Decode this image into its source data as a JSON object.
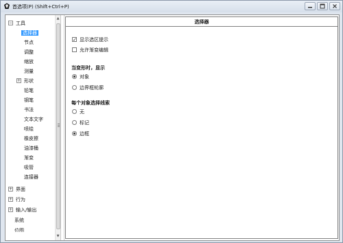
{
  "window": {
    "title": "首选项(P) (Shift+Ctrl+P)"
  },
  "tree": {
    "items": [
      {
        "label": "工具",
        "expander": "−",
        "level": 0
      },
      {
        "label": "选择器",
        "level": 1,
        "selected": true
      },
      {
        "label": "节点",
        "level": 1
      },
      {
        "label": "调整",
        "level": 1
      },
      {
        "label": "缩放",
        "level": 1
      },
      {
        "label": "测量",
        "level": 1
      },
      {
        "label": "形状",
        "expander": "+",
        "level": 1
      },
      {
        "label": "铅笔",
        "level": 1
      },
      {
        "label": "钢笔",
        "level": 1
      },
      {
        "label": "书法",
        "level": 1
      },
      {
        "label": "文本文字",
        "level": 1
      },
      {
        "label": "喷绘",
        "level": 1
      },
      {
        "label": "橡皮擦",
        "level": 1
      },
      {
        "label": "油漆桶",
        "level": 1
      },
      {
        "label": "渐变",
        "level": 1
      },
      {
        "label": "吸管",
        "level": 1
      },
      {
        "label": "连接器",
        "level": 1
      },
      {
        "label": "界面",
        "expander": "+",
        "level": 0
      },
      {
        "label": "行为",
        "expander": "+",
        "level": 0
      },
      {
        "label": "输入/输出",
        "expander": "+",
        "level": 0
      },
      {
        "label": "系统",
        "level": 0
      },
      {
        "label": "位图",
        "level": 0
      }
    ]
  },
  "panel": {
    "title": "选择器",
    "checkboxes": [
      {
        "label": "显示选区提示",
        "checked": true
      },
      {
        "label": "允许渐变编辑",
        "checked": false
      }
    ],
    "transform_section": {
      "title": "当变形时，显示",
      "options": [
        {
          "label": "对象",
          "selected": true
        },
        {
          "label": "边界框轮廓",
          "selected": false
        }
      ]
    },
    "per_object_section": {
      "title": "每个对象选择线索",
      "options": [
        {
          "label": "无",
          "selected": false
        },
        {
          "label": "标记",
          "selected": false
        },
        {
          "label": "边框",
          "selected": true
        }
      ]
    }
  }
}
